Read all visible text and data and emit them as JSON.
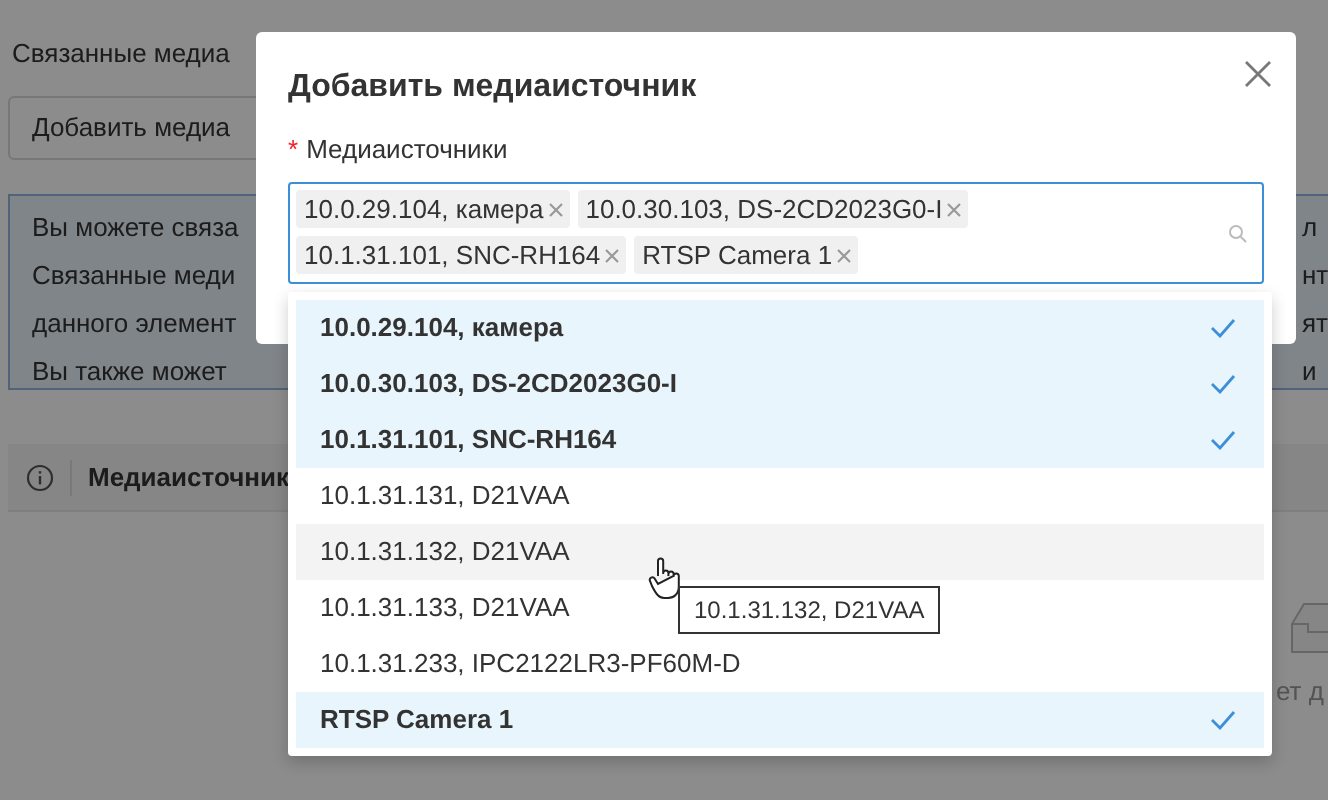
{
  "background": {
    "heading": "Связанные медиа",
    "add_button": "Добавить медиа",
    "info_lines": [
      {
        "left": "Вы можете связа",
        "right": "л"
      },
      {
        "left": "Связанные меди",
        "right": "нт"
      },
      {
        "left": "данного элемент",
        "right": "ят"
      },
      {
        "left": "Вы также может",
        "right": "и"
      }
    ],
    "table_header": "Медиаисточник",
    "empty_text": "ет д"
  },
  "dialog": {
    "title": "Добавить медиаисточник",
    "required_mark": "*",
    "field_label": "Медиаисточники",
    "tags": [
      {
        "label": "10.0.29.104, камера"
      },
      {
        "label": "10.0.30.103, DS-2CD2023G0-I"
      },
      {
        "label": "10.1.31.101, SNC-RH164"
      },
      {
        "label": "RTSP Camera 1"
      }
    ],
    "options": [
      {
        "label": "10.0.29.104, камера",
        "selected": true,
        "hovered": false
      },
      {
        "label": "10.0.30.103, DS-2CD2023G0-I",
        "selected": true,
        "hovered": false
      },
      {
        "label": "10.1.31.101, SNC-RH164",
        "selected": true,
        "hovered": false
      },
      {
        "label": "10.1.31.131, D21VAA",
        "selected": false,
        "hovered": false
      },
      {
        "label": "10.1.31.132, D21VAA",
        "selected": false,
        "hovered": true
      },
      {
        "label": "10.1.31.133, D21VAA",
        "selected": false,
        "hovered": false
      },
      {
        "label": "10.1.31.233, IPC2122LR3-PF60M-D",
        "selected": false,
        "hovered": false
      },
      {
        "label": "RTSP Camera 1",
        "selected": true,
        "hovered": false
      }
    ],
    "tooltip": "10.1.31.132, D21VAA"
  }
}
